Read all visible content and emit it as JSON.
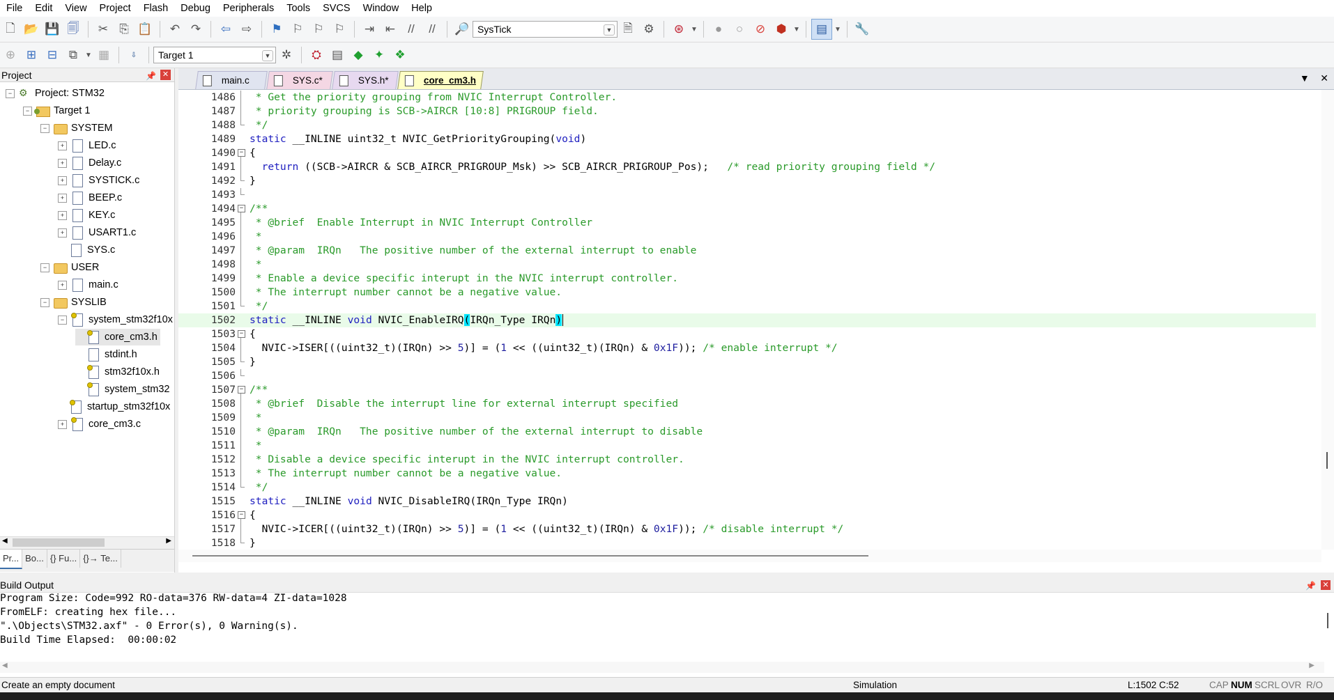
{
  "menu": [
    "File",
    "Edit",
    "View",
    "Project",
    "Flash",
    "Debug",
    "Peripherals",
    "Tools",
    "SVCS",
    "Window",
    "Help"
  ],
  "toolbar": {
    "find_combo_value": "SysTick",
    "target_combo_value": "Target 1"
  },
  "project_pane": {
    "title": "Project",
    "tree": [
      {
        "label": "Project: STM32",
        "level": 0,
        "exp": "-",
        "icon": "proj"
      },
      {
        "label": "Target 1",
        "level": 1,
        "exp": "-",
        "icon": "target"
      },
      {
        "label": "SYSTEM",
        "level": 2,
        "exp": "-",
        "icon": "folder"
      },
      {
        "label": "LED.c",
        "level": 3,
        "exp": "+",
        "icon": "file"
      },
      {
        "label": "Delay.c",
        "level": 3,
        "exp": "+",
        "icon": "file"
      },
      {
        "label": "SYSTICK.c",
        "level": 3,
        "exp": "+",
        "icon": "file"
      },
      {
        "label": "BEEP.c",
        "level": 3,
        "exp": "+",
        "icon": "file"
      },
      {
        "label": "KEY.c",
        "level": 3,
        "exp": "+",
        "icon": "file"
      },
      {
        "label": "USART1.c",
        "level": 3,
        "exp": "+",
        "icon": "file"
      },
      {
        "label": "SYS.c",
        "level": 3,
        "exp": "",
        "icon": "file"
      },
      {
        "label": "USER",
        "level": 2,
        "exp": "-",
        "icon": "folder"
      },
      {
        "label": "main.c",
        "level": 3,
        "exp": "+",
        "icon": "file"
      },
      {
        "label": "SYSLIB",
        "level": 2,
        "exp": "-",
        "icon": "folder"
      },
      {
        "label": "system_stm32f10x",
        "level": 3,
        "exp": "-",
        "icon": "hfile"
      },
      {
        "label": "core_cm3.h",
        "level": 4,
        "exp": "",
        "icon": "hfile"
      },
      {
        "label": "stdint.h",
        "level": 4,
        "exp": "",
        "icon": "file"
      },
      {
        "label": "stm32f10x.h",
        "level": 4,
        "exp": "",
        "icon": "hfile"
      },
      {
        "label": "system_stm32",
        "level": 4,
        "exp": "",
        "icon": "hfile"
      },
      {
        "label": "startup_stm32f10x",
        "level": 3,
        "exp": "",
        "icon": "hfile"
      },
      {
        "label": "core_cm3.c",
        "level": 3,
        "exp": "+",
        "icon": "hfile"
      }
    ],
    "bottom_tabs": [
      "Pr...",
      "Bo...",
      "{} Fu...",
      "{}→ Te..."
    ]
  },
  "editor": {
    "tabs": [
      {
        "label": "main.c",
        "active": false,
        "bg": "#e0e4f0"
      },
      {
        "label": "SYS.c*",
        "active": false,
        "bg": "#f4d7e4"
      },
      {
        "label": "SYS.h*",
        "active": false,
        "bg": "#e7d9f0"
      },
      {
        "label": "core_cm3.h",
        "active": true,
        "bg": "#ffffc6"
      }
    ],
    "lines": [
      {
        "n": "1486",
        "fold": "line",
        "seg": [
          [
            "cm",
            " * Get the priority grouping from NVIC Interrupt Controller."
          ]
        ]
      },
      {
        "n": "1487",
        "fold": "line",
        "seg": [
          [
            "cm",
            " * priority grouping is SCB->AIRCR [10:8] PRIGROUP field."
          ]
        ]
      },
      {
        "n": "1488",
        "fold": "end",
        "seg": [
          [
            "cm",
            " */"
          ]
        ]
      },
      {
        "n": "1489",
        "fold": "",
        "seg": [
          [
            "kw",
            "static"
          ],
          [
            "pln",
            " __INLINE uint32_t NVIC_GetPriorityGrouping("
          ],
          [
            "kw",
            "void"
          ],
          [
            "pln",
            ")"
          ]
        ]
      },
      {
        "n": "1490",
        "fold": "box",
        "seg": [
          [
            "pln",
            "{"
          ]
        ]
      },
      {
        "n": "1491",
        "fold": "line",
        "seg": [
          [
            "pln",
            "  "
          ],
          [
            "kw",
            "return"
          ],
          [
            "pln",
            " ((SCB->AIRCR & SCB_AIRCR_PRIGROUP_Msk) >> SCB_AIRCR_PRIGROUP_Pos);   "
          ],
          [
            "cm",
            "/* read priority grouping field */"
          ]
        ]
      },
      {
        "n": "1492",
        "fold": "end",
        "seg": [
          [
            "pln",
            "}"
          ]
        ]
      },
      {
        "n": "1493",
        "fold": "tick",
        "seg": []
      },
      {
        "n": "1494",
        "fold": "box",
        "seg": [
          [
            "cm",
            "/**"
          ]
        ]
      },
      {
        "n": "1495",
        "fold": "line",
        "seg": [
          [
            "cm",
            " * @brief  Enable Interrupt in NVIC Interrupt Controller"
          ]
        ]
      },
      {
        "n": "1496",
        "fold": "line",
        "seg": [
          [
            "cm",
            " *"
          ]
        ]
      },
      {
        "n": "1497",
        "fold": "line",
        "seg": [
          [
            "cm",
            " * @param  IRQn   The positive number of the external interrupt to enable"
          ]
        ]
      },
      {
        "n": "1498",
        "fold": "line",
        "seg": [
          [
            "cm",
            " *"
          ]
        ]
      },
      {
        "n": "1499",
        "fold": "line",
        "seg": [
          [
            "cm",
            " * Enable a device specific interupt in the NVIC interrupt controller."
          ]
        ]
      },
      {
        "n": "1500",
        "fold": "line",
        "seg": [
          [
            "cm",
            " * The interrupt number cannot be a negative value."
          ]
        ]
      },
      {
        "n": "1501",
        "fold": "end",
        "seg": [
          [
            "cm",
            " */"
          ]
        ]
      },
      {
        "n": "1502",
        "fold": "",
        "hl": true,
        "seg": [
          [
            "kw",
            "static"
          ],
          [
            "pln",
            " __INLINE "
          ],
          [
            "kw",
            "void"
          ],
          [
            "pln",
            " NVIC_EnableIRQ"
          ],
          [
            "brh",
            "("
          ],
          [
            "pln",
            "IRQn_Type IRQn"
          ],
          [
            "brh",
            ")"
          ]
        ]
      },
      {
        "n": "1503",
        "fold": "box",
        "seg": [
          [
            "pln",
            "{"
          ]
        ]
      },
      {
        "n": "1504",
        "fold": "line",
        "seg": [
          [
            "pln",
            "  NVIC->ISER[((uint32_t)(IRQn) >> "
          ],
          [
            "num",
            "5"
          ],
          [
            "pln",
            ")] = ("
          ],
          [
            "num",
            "1"
          ],
          [
            "pln",
            " << ((uint32_t)(IRQn) & "
          ],
          [
            "num",
            "0x1F"
          ],
          [
            "pln",
            "));"
          ],
          [
            "cm",
            " /* enable interrupt */"
          ]
        ]
      },
      {
        "n": "1505",
        "fold": "end",
        "seg": [
          [
            "pln",
            "}"
          ]
        ]
      },
      {
        "n": "1506",
        "fold": "tick",
        "seg": []
      },
      {
        "n": "1507",
        "fold": "box",
        "seg": [
          [
            "cm",
            "/**"
          ]
        ]
      },
      {
        "n": "1508",
        "fold": "line",
        "seg": [
          [
            "cm",
            " * @brief  Disable the interrupt line for external interrupt specified"
          ]
        ]
      },
      {
        "n": "1509",
        "fold": "line",
        "seg": [
          [
            "cm",
            " *"
          ]
        ]
      },
      {
        "n": "1510",
        "fold": "line",
        "seg": [
          [
            "cm",
            " * @param  IRQn   The positive number of the external interrupt to disable"
          ]
        ]
      },
      {
        "n": "1511",
        "fold": "line",
        "seg": [
          [
            "cm",
            " *"
          ]
        ]
      },
      {
        "n": "1512",
        "fold": "line",
        "seg": [
          [
            "cm",
            " * Disable a device specific interupt in the NVIC interrupt controller."
          ]
        ]
      },
      {
        "n": "1513",
        "fold": "line",
        "seg": [
          [
            "cm",
            " * The interrupt number cannot be a negative value."
          ]
        ]
      },
      {
        "n": "1514",
        "fold": "end",
        "seg": [
          [
            "cm",
            " */"
          ]
        ]
      },
      {
        "n": "1515",
        "fold": "",
        "seg": [
          [
            "kw",
            "static"
          ],
          [
            "pln",
            " __INLINE "
          ],
          [
            "kw",
            "void"
          ],
          [
            "pln",
            " NVIC_DisableIRQ(IRQn_Type IRQn)"
          ]
        ]
      },
      {
        "n": "1516",
        "fold": "box",
        "seg": [
          [
            "pln",
            "{"
          ]
        ]
      },
      {
        "n": "1517",
        "fold": "line",
        "seg": [
          [
            "pln",
            "  NVIC->ICER[((uint32_t)(IRQn) >> "
          ],
          [
            "num",
            "5"
          ],
          [
            "pln",
            ")] = ("
          ],
          [
            "num",
            "1"
          ],
          [
            "pln",
            " << ((uint32_t)(IRQn) & "
          ],
          [
            "num",
            "0x1F"
          ],
          [
            "pln",
            "));"
          ],
          [
            "cm",
            " /* disable interrupt */"
          ]
        ]
      },
      {
        "n": "1518",
        "fold": "end",
        "seg": [
          [
            "pln",
            "}"
          ]
        ]
      }
    ]
  },
  "build_output": {
    "title": "Build Output",
    "lines": [
      "Program Size: Code=992 RO-data=376 RW-data=4 ZI-data=1028",
      "FromELF: creating hex file...",
      "\".\\Objects\\STM32.axf\" - 0 Error(s), 0 Warning(s).",
      "Build Time Elapsed:  00:00:02"
    ]
  },
  "status": {
    "message": "Create an empty document",
    "mode": "Simulation",
    "position": "L:1502 C:52",
    "cap": "CAP",
    "num": "NUM",
    "scrl": "SCRL",
    "ovr": "OVR",
    "ro": "R/O"
  },
  "colors": {
    "comment": "#2a9a2a",
    "keyword": "#2020c0",
    "current_line": "#e9fbe9",
    "brace_match": "#00e5ff",
    "close_button": "#d9413a"
  }
}
